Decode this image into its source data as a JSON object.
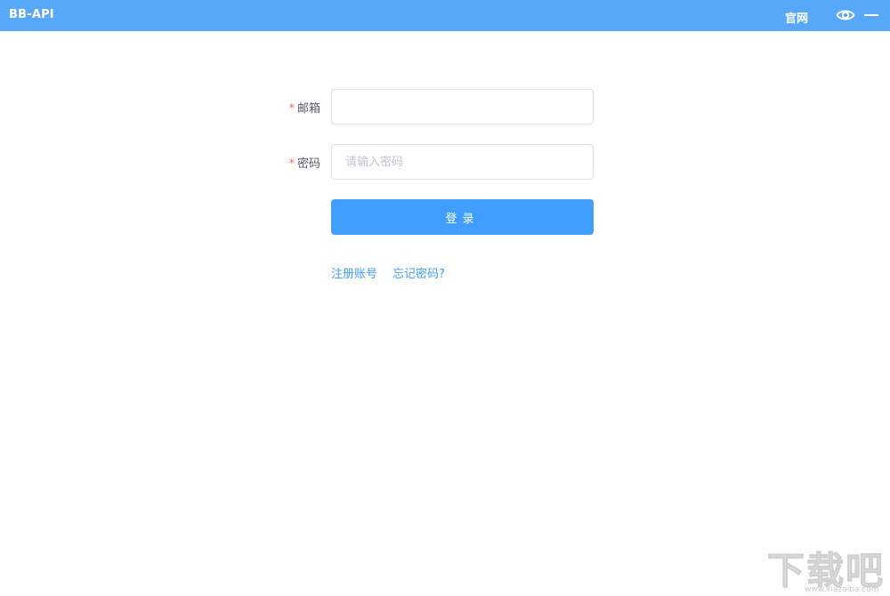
{
  "window": {
    "title": "BB-API",
    "official_site_label": "官网",
    "eye_icon": "eye-icon",
    "minimize_icon": "minimize-icon",
    "titlebar_color": "#58a8fa"
  },
  "login_form": {
    "email": {
      "required_mark": "*",
      "label": "邮箱",
      "value": "",
      "placeholder": ""
    },
    "password": {
      "required_mark": "*",
      "label": "密码",
      "value": "",
      "placeholder": "请输入密码"
    },
    "login_button_label": "登录",
    "register_link": "注册账号",
    "forgot_password_link": "忘记密码?",
    "primary_color": "#409eff"
  },
  "watermark": {
    "text": "下载吧",
    "subtext": "www.xiazaiba.com"
  }
}
